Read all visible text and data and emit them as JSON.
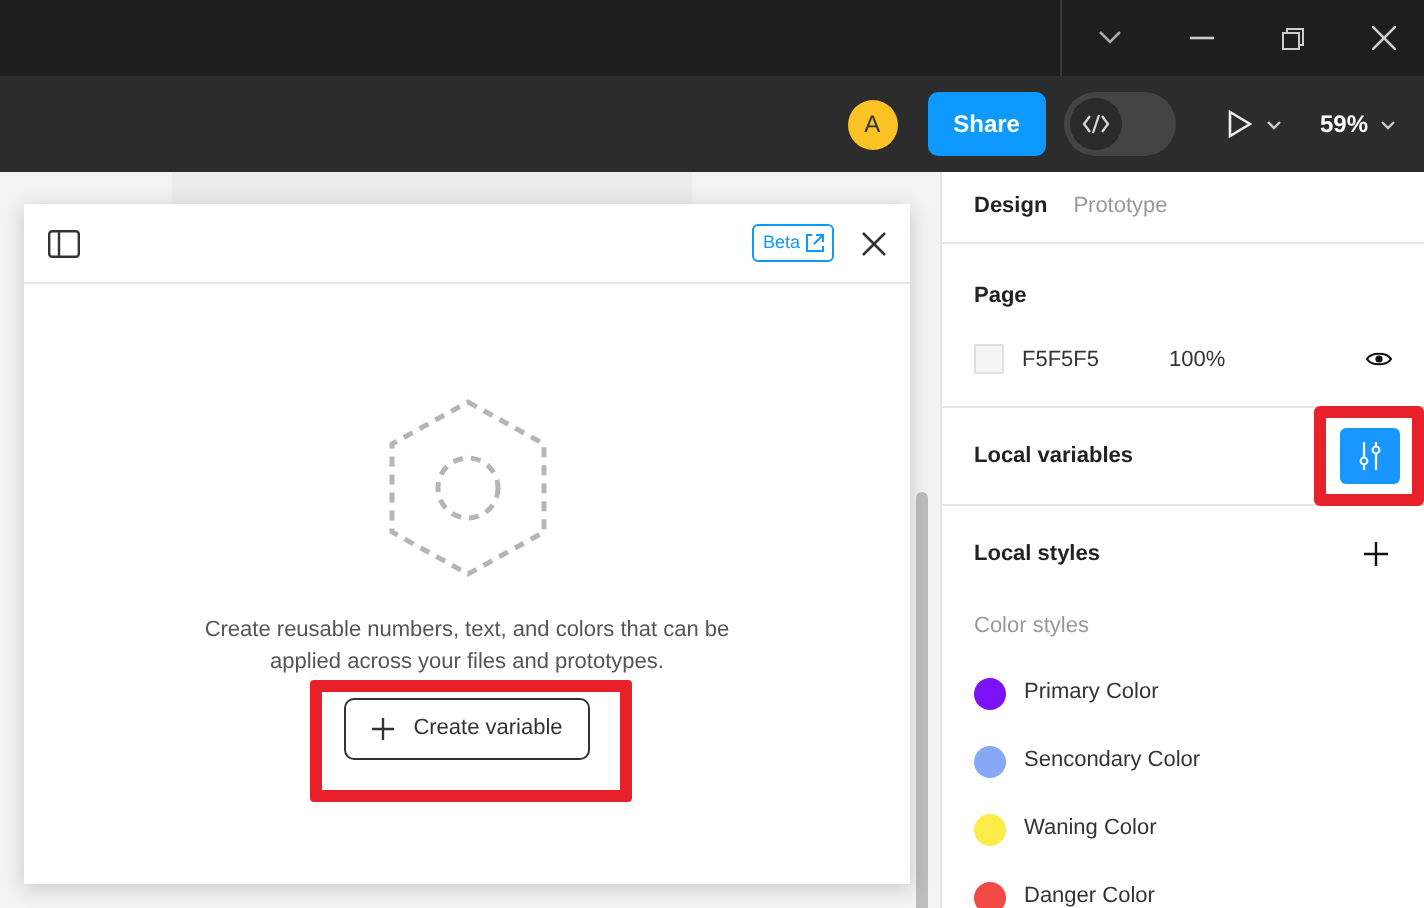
{
  "toolbar": {
    "avatar": "A",
    "share": "Share",
    "dev_mode": {
      "on": false
    },
    "zoom": "59%"
  },
  "modal": {
    "badge": "Beta",
    "message": "Create reusable numbers, text, and colors that can be applied across your files and prototypes.",
    "button": "Create variable"
  },
  "panel": {
    "tabs": [
      {
        "label": "Design",
        "selected": true
      },
      {
        "label": "Prototype",
        "selected": false
      }
    ],
    "page": {
      "heading": "Page",
      "hex_value": "F5F5F5",
      "opacity": "100%"
    },
    "local_variables": "Local variables",
    "local_styles": "Local styles",
    "color_styles_heading": "Color styles",
    "color_styles": [
      {
        "name": "Primary Color",
        "color": "#7b12f5"
      },
      {
        "name": "Sencondary Color",
        "color": "#86a8f7"
      },
      {
        "name": "Waning Color",
        "color": "#fbec4a"
      },
      {
        "name": "Danger Color",
        "color": "#f24a45"
      }
    ]
  }
}
